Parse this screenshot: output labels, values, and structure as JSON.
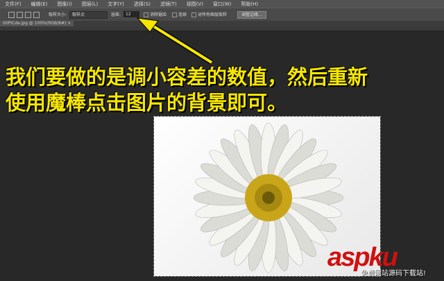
{
  "menu": [
    "文件(F)",
    "编辑(E)",
    "图像(I)",
    "图层(L)",
    "文字(Y)",
    "选择(S)",
    "滤镜(T)",
    "视图(V)",
    "窗口(W)",
    "帮助(H)"
  ],
  "options": {
    "sample_size_label": "取样大小:",
    "sample_size_value": "取样点",
    "tolerance_label": "容差:",
    "tolerance_value": "12",
    "antialias": "消除锯齿",
    "contiguous": "连续",
    "sample_all": "对所有图层取样",
    "refine_edge": "调整边缘..."
  },
  "tab": {
    "title": "00PICda.jpg @ 100%(RGB/8#)",
    "close": "×"
  },
  "caption": {
    "line1": "我们要做的是调小容差的数值，然后重新",
    "line2": "使用魔棒点击图片的背景即可。"
  },
  "watermark": {
    "brand": "aspku",
    "sub": "免费网站源码下载站!"
  },
  "colors": {
    "caption": "#f5e600",
    "watermark": "#d01010"
  }
}
